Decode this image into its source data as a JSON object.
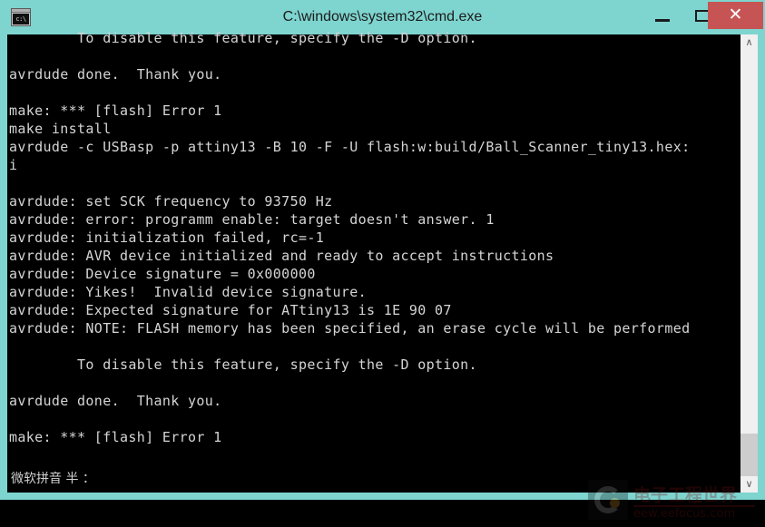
{
  "window": {
    "title": "C:\\windows\\system32\\cmd.exe",
    "icon_name": "cmd-console-icon",
    "icon_glyph": "c:\\",
    "titlebar_color": "#7ed4cf",
    "close_button_color": "#c75454",
    "controls": {
      "minimize_label": "–",
      "maximize_label": "□",
      "close_label": "✕"
    }
  },
  "console": {
    "background_color": "#000000",
    "foreground_color": "#d5d5d5",
    "lines": [
      "        To disable this feature, specify the -D option.",
      "",
      "avrdude done.  Thank you.",
      "",
      "make: *** [flash] Error 1",
      "make install",
      "avrdude -c USBasp -p attiny13 -B 10 -F -U flash:w:build/Ball_Scanner_tiny13.hex:",
      "i",
      "",
      "avrdude: set SCK frequency to 93750 Hz",
      "avrdude: error: programm enable: target doesn't answer. 1",
      "avrdude: initialization failed, rc=-1",
      "avrdude: AVR device initialized and ready to accept instructions",
      "avrdude: Device signature = 0x000000",
      "avrdude: Yikes!  Invalid device signature.",
      "avrdude: Expected signature for ATtiny13 is 1E 90 07",
      "avrdude: NOTE: FLASH memory has been specified, an erase cycle will be performed",
      "",
      "        To disable this feature, specify the -D option.",
      "",
      "avrdude done.  Thank you.",
      "",
      "make: *** [flash] Error 1"
    ]
  },
  "ime": {
    "status_text": "微软拼音  半  ："
  },
  "scrollbar": {
    "up_arrow_glyph": "∧",
    "down_arrow_glyph": "∨"
  },
  "watermark": {
    "site_name": "电子工程世界",
    "url": "eew.eefocus.com",
    "logo_name": "eeworld-c-logo"
  }
}
